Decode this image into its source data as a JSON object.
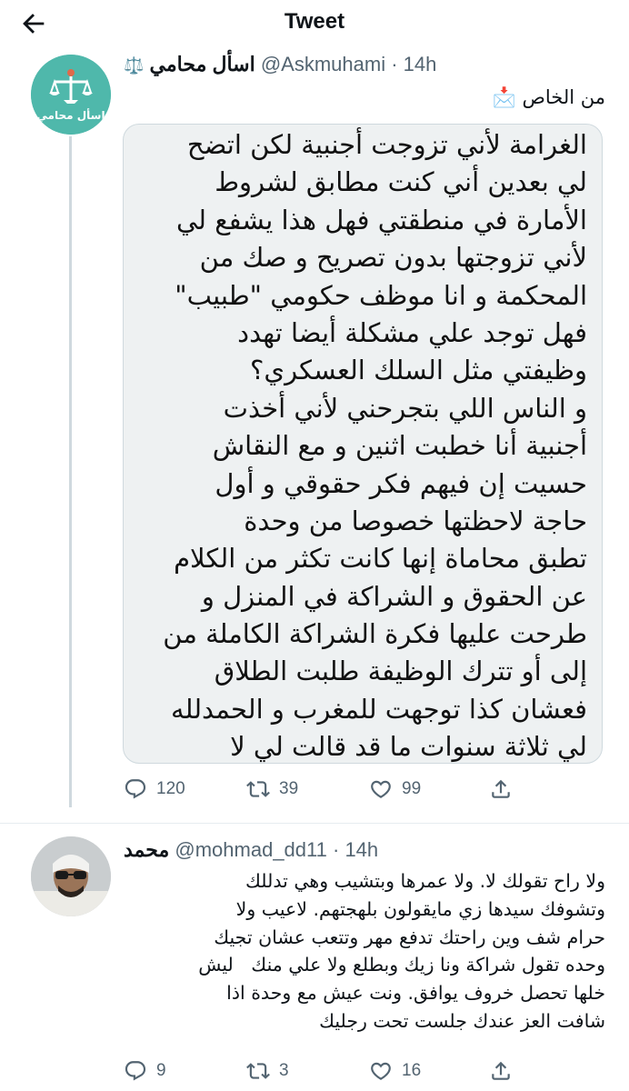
{
  "header": {
    "title": "Tweet"
  },
  "tweet1": {
    "author_name": "اسأل محامي",
    "scales_emoji": "⚖️",
    "handle": "@Askmuhami",
    "time": "· 14h",
    "avatar_label": "اسأل محامي",
    "text": "من الخاص",
    "text_emoji": "📩",
    "image_lines": [
      "الغرامة لأني تزوجت أجنبية لكن اتضح",
      "لي بعدين أني كنت مطابق لشروط",
      "الأمارة في منطقتي فهل هذا يشفع لي",
      "لأني تزوجتها بدون تصريح و صك من",
      "المحكمة و انا موظف حكومي \"طبيب\"",
      "فهل توجد علي مشكلة أيضا تهدد",
      "وظيفتي مثل السلك العسكري؟",
      "و الناس اللي بتجرحني لأني أخذت",
      "أجنبية أنا خطبت اثنين و مع النقاش",
      "حسيت إن فيهم فكر حقوقي و أول",
      "حاجة لاحظتها خصوصا من وحدة",
      "تطبق محاماة إنها كانت تكثر من الكلام",
      "عن الحقوق و الشراكة في المنزل و",
      "طرحت عليها فكرة الشراكة الكاملة من",
      "إلى أو تترك الوظيفة طلبت الطلاق",
      "فعشان كذا توجهت للمغرب و الحمدلله",
      "لي ثلاثة سنوات ما قد قالت لي لا"
    ],
    "stats": {
      "replies": "120",
      "retweets": "39",
      "likes": "99"
    }
  },
  "tweet2": {
    "author_name": "محمد",
    "handle": "@mohmad_dd11",
    "time": "· 14h",
    "lines": [
      "ولا راح تقولك لا. ولا عمرها وبتشيب وهي تدللك",
      "وتشوفك سيدها زي مايقولون بلهجتهم. لاعيب ولا",
      "حرام شف وين راحتك تدفع مهر وتتعب عشان تجيك",
      "وحده تقول شراكة ونا زيك وبطلع ولا علي منك   ليش",
      "خلها تحصل خروف يوافق. ونت عيش مع وحدة اذا",
      "شافت العز عندك جلست تحت رجليك"
    ],
    "stats": {
      "replies": "9",
      "retweets": "3",
      "likes": "16"
    }
  },
  "colors": {
    "brand_teal": "#4fb8ab",
    "muted": "#536471",
    "thread_line": "#cfd9de"
  }
}
